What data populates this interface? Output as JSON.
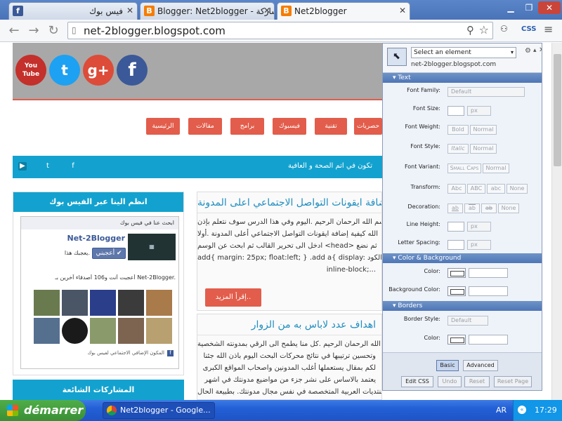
{
  "browser": {
    "tabs": [
      {
        "label": "فيس بوك",
        "favicon": "f"
      },
      {
        "label": "Blogger: Net2blogger - مشاركة",
        "favicon": "B"
      },
      {
        "label": "Net2blogger",
        "favicon": "B"
      }
    ],
    "url": "net-2blogger.blogspot.com",
    "css_button": "CSS"
  },
  "page": {
    "social": [
      "You Tube",
      "t",
      "g+",
      "f"
    ],
    "nav": [
      "حصريات",
      "تقنية",
      "فيسبوك",
      "برامج",
      "مقالات",
      "الرئيسية"
    ],
    "ticker": "تكون في اتم الصحة و العافية",
    "fb_widget": {
      "title": "انظم الينا عبر الفيس بوك",
      "box_header": "ابحث عنا في فيس بوك",
      "page_name": "Net-2Blogger",
      "like_label": "أعجبني",
      "like_sub": "يعجبك هذا.",
      "friends_text": "أعجبت أنت و106 أصدقاء آخرين بـ Net-2Blogger.",
      "plugin_text": "المكون الإضافي الاجتماعي لفيس بوك"
    },
    "popular_title": "المشاركات الشائعة",
    "posts": [
      {
        "title": "اضافة ايقونات التواصل الاجتماعي اعلى المدونة",
        "lines": [
          "بسم الله الرحمان الرحيم .اليوم وفي هذا الدرس سوف نتعلم بإذن",
          "الله كيفية إضافة ايقونات التواصل الاجتماعي أعلى المدونة .أولا",
          "ادخل الى تحرير القالب ثم ابحث عن الوسم <head> ثم نضع",
          "add{ margin: 25px; float:left; } .add a{ display: الكود",
          "inline-block;..."
        ],
        "read_more": "إقرأ المزيد.."
      },
      {
        "title": "اهداف عدد لاباس به من الزوار",
        "lines": [
          "بسم الله الرحمان الرحيم .كل منا يطمح الى الرقي بمدونته الشخصية",
          "وتحسين ترتيبها في نتائج محركات البحث اليوم باذن الله جئنا",
          "لكم بمقال يستعملها أغلب المدونين واصحاب المواقع الكبرى",
          "يعتمد بالاساس على نشر جزء من مواضيع مدونتك في اشهر",
          "المنتديات العربية المتخصصة في نفس مجال مدونتك. بطبيعة الحال"
        ]
      }
    ]
  },
  "css_panel": {
    "select_placeholder": "Select an element",
    "host": "net-2blogger.blogspot.com",
    "sections": {
      "text": "Text",
      "color": "Color & Background",
      "borders": "Borders"
    },
    "labels": {
      "font_family": "Font Family:",
      "font_size": "Font Size:",
      "font_weight": "Font Weight:",
      "font_style": "Font Style:",
      "font_variant": "Font Variant:",
      "transform": "Transform:",
      "decoration": "Decoration:",
      "line_height": "Line Height:",
      "letter_spacing": "Letter Spacing:",
      "color": "Color:",
      "bg_color": "Background Color:",
      "border_style": "Border Style:",
      "border_color": "Color:"
    },
    "values": {
      "default": "Default",
      "px": "px",
      "bold": "Bold",
      "normal": "Normal",
      "italic": "Italic",
      "small_caps": "Small Caps",
      "abc1": "Abc",
      "abc2": "ABC",
      "abc3": "abc",
      "none": "None",
      "ab1": "ab",
      "ab2": "ab",
      "ab3": "ab"
    },
    "buttons": {
      "basic": "Basic",
      "advanced": "Advanced",
      "edit_css": "Edit CSS",
      "undo": "Undo",
      "reset": "Reset",
      "reset_page": "Reset Page"
    }
  },
  "taskbar": {
    "start": "démarrer",
    "task": "Net2blogger - Google...",
    "lang": "AR",
    "time": "17:29"
  },
  "colors": {
    "accent_blue": "#13a2cf",
    "accent_red": "#e25d4b"
  }
}
